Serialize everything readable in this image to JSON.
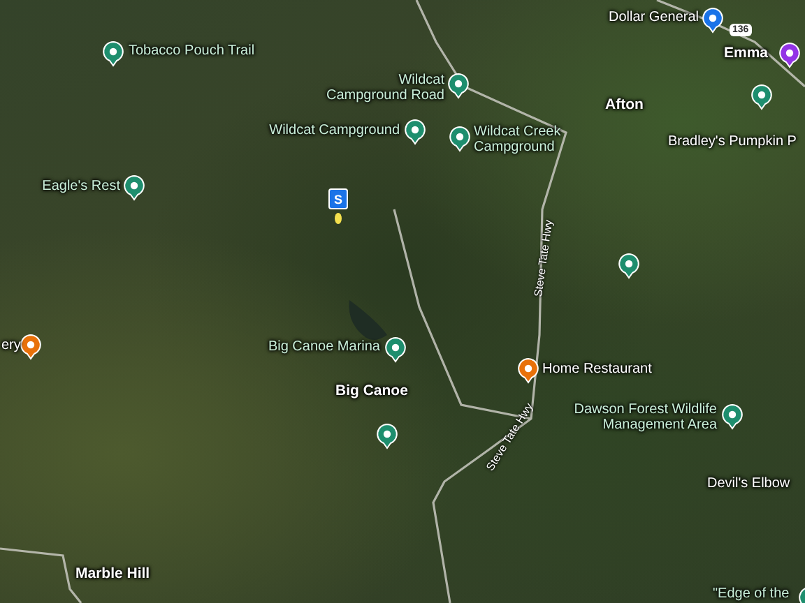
{
  "map": {
    "places": [
      {
        "kind": "pin",
        "color": "#1a73e8",
        "lines": [
          "Dollar General"
        ]
      },
      {
        "kind": "shield",
        "lines": [
          "136"
        ]
      },
      {
        "kind": "pin",
        "color": "#1e8e6e",
        "lines": [
          "Tobacco Pouch Trail"
        ]
      },
      {
        "kind": "town",
        "lines": [
          "Emma"
        ]
      },
      {
        "kind": "pin",
        "color": "#9334e6"
      },
      {
        "kind": "pin",
        "color": "#1e8e6e",
        "lines": [
          "Wildcat",
          "Campground Road"
        ]
      },
      {
        "kind": "pin",
        "color": "#1e8e6e"
      },
      {
        "kind": "town",
        "lines": [
          "Afton"
        ]
      },
      {
        "kind": "pin",
        "color": "#1e8e6e",
        "lines": [
          "Wildcat Campground"
        ]
      },
      {
        "kind": "pin",
        "color": "#1e8e6e",
        "lines": [
          "Wildcat Creek",
          "Campground"
        ]
      },
      {
        "kind": "label",
        "lines": [
          "Bradley's Pumpkin P"
        ]
      },
      {
        "kind": "pin",
        "color": "#1e8e6e",
        "lines": [
          "Eagle's Rest"
        ]
      },
      {
        "kind": "marker",
        "lines": [
          "S"
        ]
      },
      {
        "kind": "pin",
        "color": "#1e8e6e"
      },
      {
        "kind": "pin",
        "color": "#e8710a",
        "lines": [
          "ery"
        ]
      },
      {
        "kind": "pin",
        "color": "#1e8e6e",
        "lines": [
          "Big Canoe Marina"
        ]
      },
      {
        "kind": "pin",
        "color": "#e8710a",
        "lines": [
          "Home Restaurant"
        ]
      },
      {
        "kind": "town",
        "lines": [
          "Big Canoe"
        ]
      },
      {
        "kind": "pin",
        "color": "#1e8e6e",
        "lines": [
          "Dawson Forest Wildlife",
          "Management Area"
        ]
      },
      {
        "kind": "pin",
        "color": "#1e8e6e"
      },
      {
        "kind": "road",
        "lines": [
          "Steve Tate Hwy"
        ]
      },
      {
        "kind": "road",
        "lines": [
          "Steve Tate Hwy"
        ]
      },
      {
        "kind": "label",
        "lines": [
          "Devil's Elbow"
        ]
      },
      {
        "kind": "pin",
        "color": "#1e8e6e",
        "lines": [
          "\"Edge of the"
        ]
      },
      {
        "kind": "town",
        "lines": [
          "Marble Hill"
        ]
      }
    ]
  }
}
